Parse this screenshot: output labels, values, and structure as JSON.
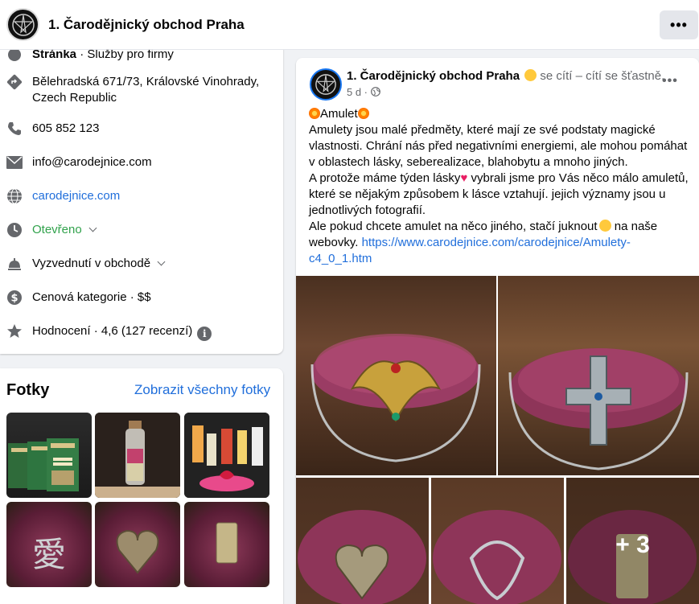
{
  "header": {
    "title": "1. Čarodějnický obchod Praha",
    "more_label": "•••"
  },
  "intro": {
    "page_type_bold": "Stránka",
    "page_type_rest": " · Služby pro firmy",
    "address": [
      "Bělehradská 671/73, Královské Vinohrady,",
      "Czech Republic"
    ],
    "phone": "605 852 123",
    "email": "info@carodejnice.com",
    "website": "carodejnice.com",
    "hours": "Otevřeno",
    "pickup": "Vyzvednutí v obchodě",
    "price": "Cenová kategorie · $$",
    "rating": "Hodnocení · 4,6 (127 recenzí)",
    "rating_info": "i"
  },
  "photos": {
    "title": "Fotky",
    "see_all": "Zobrazit všechny fotky"
  },
  "post": {
    "author": "1. Čarodějnický obchod Praha",
    "feeling": " se cítí – cítí se šťastně.",
    "time": "5 d · ",
    "menu": "•••",
    "heading": "Amulet",
    "lines": [
      "Amulety jsou malé předměty, které mají ze své podstaty magické vlastnosti. Chrání nás před negativními energiemi, ale mohou pomáhat v oblastech lásky, seberealizace, blahobytu a mnoho jiných.",
      "A protože máme týden lásky",
      " vybrali jsme pro Vás něco málo amuletů, které se nějakým způsobem k lásce vztahují. jejich významy jsou u jednotlivých fotografií.",
      "Ale pokud chcete amulet na něco jiného, stačí juknout",
      " na naše webovky. ",
      "https://www.carodejnice.com/carodejnice/Amulety-c4_0_1.htm"
    ],
    "more_photos": "+ 3"
  },
  "colors": {
    "link": "#216fdb",
    "open": "#31a24c",
    "petals": "#7a2748"
  }
}
